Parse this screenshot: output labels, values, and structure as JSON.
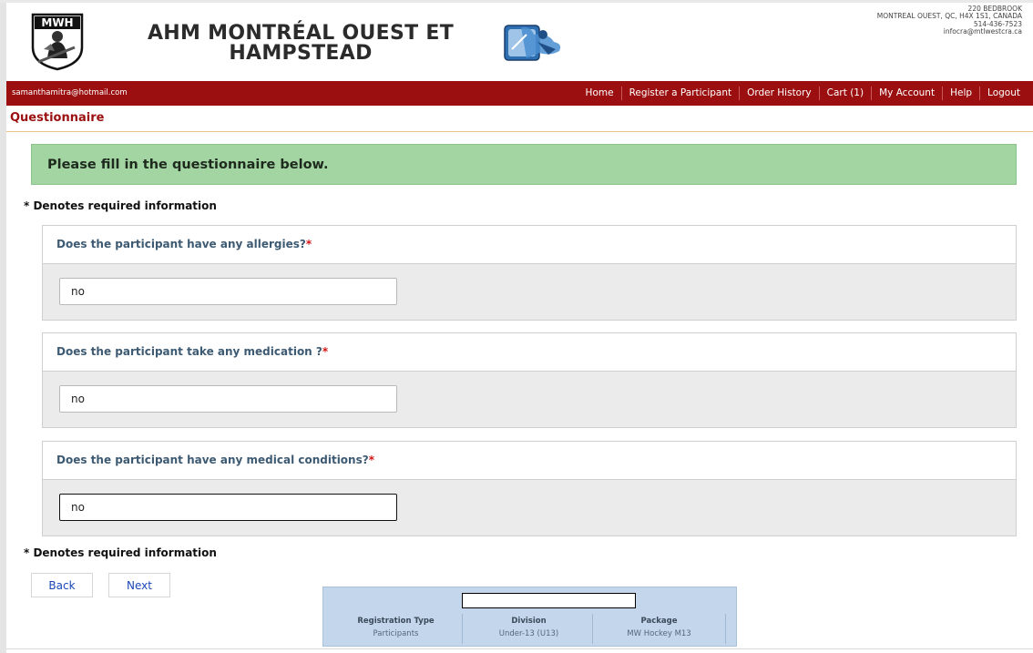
{
  "header": {
    "logo_text": "MWH",
    "org_title": "AHM MONTRÉAL OUEST ET HAMPSTEAD",
    "contact": {
      "street": "220 BEDBROOK",
      "city": "MONTREAL OUEST, QC, H4X 1S1, CANADA",
      "phone": "514-436-7523",
      "email": "infocra@mtlwestcra.ca"
    }
  },
  "nav": {
    "user_email": "samanthamitra@hotmail.com",
    "links": [
      "Home",
      "Register a Participant",
      "Order History",
      "Cart (1)",
      "My Account",
      "Help",
      "Logout"
    ]
  },
  "page": {
    "title": "Questionnaire",
    "banner": "Please fill in the questionnaire below.",
    "required_note": "* Denotes required information",
    "required_star": "*"
  },
  "questions": [
    {
      "label": "Does the participant have any allergies?",
      "value": "no"
    },
    {
      "label": "Does the participant take any medication ?",
      "value": "no"
    },
    {
      "label": "Does the participant have any medical conditions?",
      "value": "no"
    }
  ],
  "buttons": {
    "back": "Back",
    "next": "Next"
  },
  "summary": {
    "columns": [
      {
        "header": "Registration Type",
        "value": "Participants"
      },
      {
        "header": "Division",
        "value": "Under-13 (U13)"
      },
      {
        "header": "Package",
        "value": "MW Hockey M13"
      }
    ]
  },
  "colors": {
    "nav_bar": "#9b0f10",
    "banner": "#a2d5a1",
    "question_text": "#3d5a73",
    "button_text": "#1a47b8",
    "summary_bg": "#c3d6ec"
  }
}
